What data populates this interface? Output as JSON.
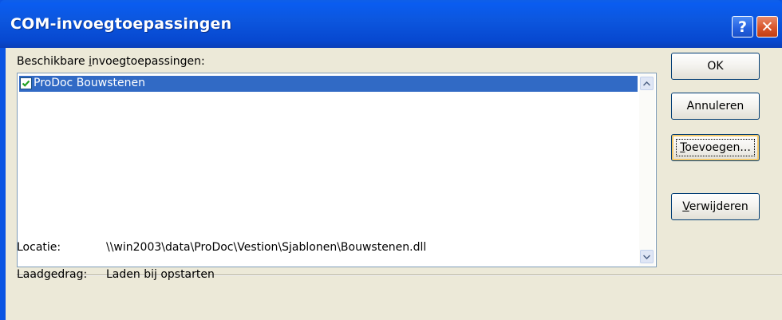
{
  "window": {
    "title": "COM-invoegtoepassingen",
    "help_glyph": "?",
    "close_glyph": "✕"
  },
  "list": {
    "label_prefix": "Beschikbare ",
    "label_accel": "i",
    "label_suffix": "nvoegtoepassingen:",
    "items": [
      {
        "label": "ProDoc Bouwstenen",
        "checked": true,
        "selected": true
      }
    ]
  },
  "buttons": {
    "ok": "OK",
    "cancel": "Annuleren",
    "add_accel": "T",
    "add_rest": "oevoegen...",
    "remove_accel": "V",
    "remove_rest": "erwijderen"
  },
  "info": {
    "location_label": "Locatie:",
    "location_value": "\\\\win2003\\data\\ProDoc\\Vestion\\Sjablonen\\Bouwstenen.dll",
    "load_label": "Laadgedrag:",
    "load_value": "Laden bij opstarten"
  },
  "colors": {
    "titlebar": "#0a54e3",
    "selection": "#316ac5",
    "client_bg": "#ece9d8",
    "close_button": "#d9562c"
  }
}
